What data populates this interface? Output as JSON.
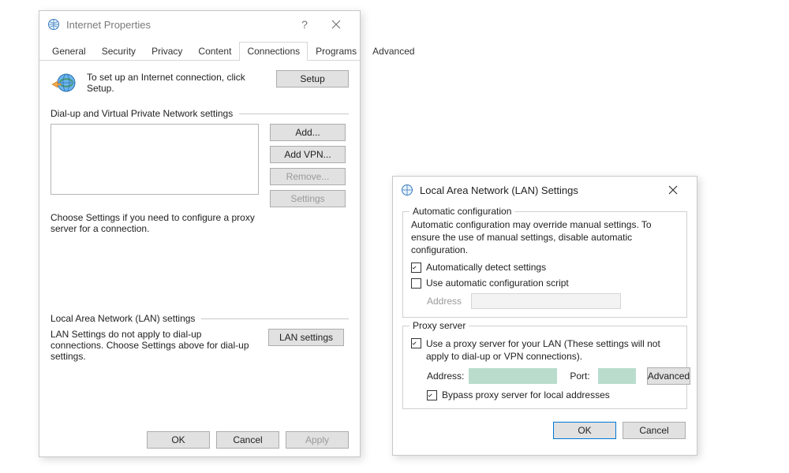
{
  "internet": {
    "title": "Internet Properties",
    "tabs": [
      "General",
      "Security",
      "Privacy",
      "Content",
      "Connections",
      "Programs",
      "Advanced"
    ],
    "active_tab_index": 4,
    "setup_text": "To set up an Internet connection, click Setup.",
    "setup_button": "Setup",
    "dialup_group": "Dial-up and Virtual Private Network settings",
    "btn_add": "Add...",
    "btn_add_vpn": "Add VPN...",
    "btn_remove": "Remove...",
    "btn_settings": "Settings",
    "proxy_note": "Choose Settings if you need to configure a proxy server for a connection.",
    "lan_group": "Local Area Network (LAN) settings",
    "lan_note": "LAN Settings do not apply to dial-up connections. Choose Settings above for dial-up settings.",
    "btn_lan": "LAN settings",
    "btn_ok": "OK",
    "btn_cancel": "Cancel",
    "btn_apply": "Apply"
  },
  "lan": {
    "title": "Local Area Network (LAN) Settings",
    "auto_group": "Automatic configuration",
    "auto_text": "Automatic configuration may override manual settings.  To ensure the use of manual settings, disable automatic configuration.",
    "auto_detect": "Automatically detect settings",
    "auto_detect_checked": true,
    "auto_script": "Use automatic configuration script",
    "auto_script_checked": false,
    "address_label": "Address",
    "proxy_group": "Proxy server",
    "proxy_use": "Use a proxy server for your LAN (These settings will not apply to dial-up or VPN connections).",
    "proxy_use_checked": true,
    "proxy_address_label": "Address:",
    "proxy_port_label": "Port:",
    "btn_advanced": "Advanced",
    "bypass": "Bypass proxy server for local addresses",
    "bypass_checked": true,
    "btn_ok": "OK",
    "btn_cancel": "Cancel"
  }
}
